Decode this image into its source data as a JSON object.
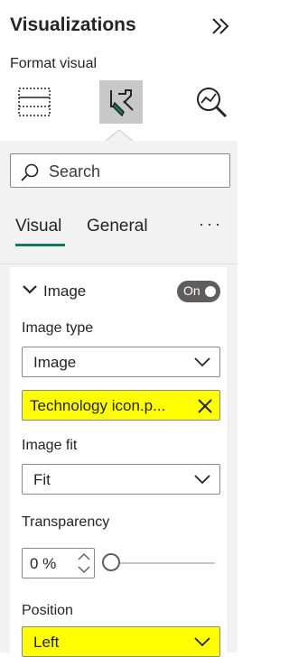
{
  "pane": {
    "title": "Visualizations",
    "format_label": "Format visual"
  },
  "search": {
    "placeholder": "Search"
  },
  "tabs": [
    {
      "label": "Visual",
      "active": true
    },
    {
      "label": "General",
      "active": false
    }
  ],
  "more_label": "···",
  "image_section": {
    "title": "Image",
    "toggle_label": "On",
    "toggle_on": true,
    "image_type_label": "Image type",
    "image_type_value": "Image",
    "file_value": "Technology icon.p...",
    "image_fit_label": "Image fit",
    "image_fit_value": "Fit",
    "transparency_label": "Transparency",
    "transparency_value": "0 %",
    "transparency_percent": 0,
    "position_label": "Position",
    "position_value": "Left"
  },
  "colors": {
    "accent": "#117865",
    "highlight": "#ffff00",
    "toggle_bg": "#605e5c"
  }
}
